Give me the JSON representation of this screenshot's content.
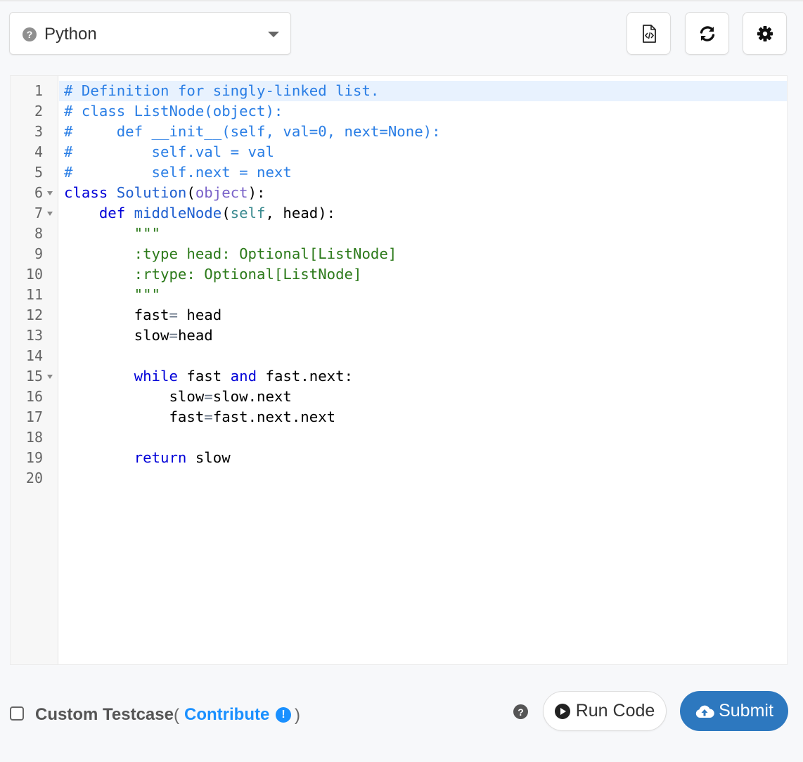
{
  "language_select": {
    "help_icon": "question-circle-icon",
    "selected": "Python",
    "caret_icon": "caret-down-icon"
  },
  "toolbar": {
    "buttons": [
      {
        "icon": "code-file-icon"
      },
      {
        "icon": "refresh-icon"
      },
      {
        "icon": "gear-icon"
      }
    ]
  },
  "editor": {
    "active_line": 1,
    "lines": [
      {
        "num": "1",
        "fold": false,
        "tokens": [
          {
            "t": "# Definition for singly-linked list.",
            "c": "comment"
          }
        ]
      },
      {
        "num": "2",
        "fold": false,
        "tokens": [
          {
            "t": "# class ListNode(object):",
            "c": "comment"
          }
        ]
      },
      {
        "num": "3",
        "fold": false,
        "tokens": [
          {
            "t": "#     def __init__(self, val=0, next=None):",
            "c": "comment"
          }
        ]
      },
      {
        "num": "4",
        "fold": false,
        "tokens": [
          {
            "t": "#         self.val = val",
            "c": "comment"
          }
        ]
      },
      {
        "num": "5",
        "fold": false,
        "tokens": [
          {
            "t": "#         self.next = next",
            "c": "comment"
          }
        ]
      },
      {
        "num": "6",
        "fold": true,
        "tokens": [
          {
            "t": "class ",
            "c": "kw"
          },
          {
            "t": "Solution",
            "c": "fn"
          },
          {
            "t": "(",
            "c": "plain"
          },
          {
            "t": "object",
            "c": "builtin"
          },
          {
            "t": "):",
            "c": "plain"
          }
        ]
      },
      {
        "num": "7",
        "fold": true,
        "tokens": [
          {
            "t": "    def ",
            "c": "kw"
          },
          {
            "t": "middleNode",
            "c": "fn"
          },
          {
            "t": "(",
            "c": "plain"
          },
          {
            "t": "self",
            "c": "selfk"
          },
          {
            "t": ", head):",
            "c": "plain"
          }
        ]
      },
      {
        "num": "8",
        "fold": false,
        "tokens": [
          {
            "t": "        \"\"\"",
            "c": "str"
          }
        ]
      },
      {
        "num": "9",
        "fold": false,
        "tokens": [
          {
            "t": "        :type head: Optional[ListNode]",
            "c": "str"
          }
        ]
      },
      {
        "num": "10",
        "fold": false,
        "tokens": [
          {
            "t": "        :rtype: Optional[ListNode]",
            "c": "str"
          }
        ]
      },
      {
        "num": "11",
        "fold": false,
        "tokens": [
          {
            "t": "        \"\"\"",
            "c": "str"
          }
        ]
      },
      {
        "num": "12",
        "fold": false,
        "tokens": [
          {
            "t": "        fast",
            "c": "plain"
          },
          {
            "t": "=",
            "c": "op"
          },
          {
            "t": " head",
            "c": "plain"
          }
        ]
      },
      {
        "num": "13",
        "fold": false,
        "tokens": [
          {
            "t": "        slow",
            "c": "plain"
          },
          {
            "t": "=",
            "c": "op"
          },
          {
            "t": "head",
            "c": "plain"
          }
        ]
      },
      {
        "num": "14",
        "fold": false,
        "tokens": [
          {
            "t": "",
            "c": "plain"
          }
        ]
      },
      {
        "num": "15",
        "fold": true,
        "tokens": [
          {
            "t": "        while",
            "c": "kw"
          },
          {
            "t": " fast ",
            "c": "plain"
          },
          {
            "t": "and",
            "c": "kw"
          },
          {
            "t": " fast.next:",
            "c": "plain"
          }
        ]
      },
      {
        "num": "16",
        "fold": false,
        "tokens": [
          {
            "t": "            slow",
            "c": "plain"
          },
          {
            "t": "=",
            "c": "op"
          },
          {
            "t": "slow.next",
            "c": "plain"
          }
        ]
      },
      {
        "num": "17",
        "fold": false,
        "tokens": [
          {
            "t": "            fast",
            "c": "plain"
          },
          {
            "t": "=",
            "c": "op"
          },
          {
            "t": "fast.next.next",
            "c": "plain"
          }
        ]
      },
      {
        "num": "18",
        "fold": false,
        "tokens": [
          {
            "t": "",
            "c": "plain"
          }
        ]
      },
      {
        "num": "19",
        "fold": false,
        "tokens": [
          {
            "t": "        return",
            "c": "kw"
          },
          {
            "t": " slow",
            "c": "plain"
          }
        ]
      },
      {
        "num": "20",
        "fold": false,
        "tokens": [
          {
            "t": "",
            "c": "plain"
          }
        ]
      }
    ]
  },
  "footer": {
    "custom_testcase_label": "Custom Testcase",
    "paren_open": "(",
    "contribute_label": "Contribute",
    "contribute_icon": "exclamation-circle-icon",
    "paren_close": ")",
    "help_icon": "question-circle-icon",
    "run_label": "Run Code",
    "run_icon": "play-circle-icon",
    "submit_label": "Submit",
    "submit_icon": "cloud-upload-icon"
  },
  "colors": {
    "submit_bg": "#2d78bf",
    "contribute": "#1a90ff",
    "comment": "#2a7ee5",
    "keyword": "#0000d8",
    "string": "#2c7a1a",
    "active_line": "#e8f2fe"
  }
}
